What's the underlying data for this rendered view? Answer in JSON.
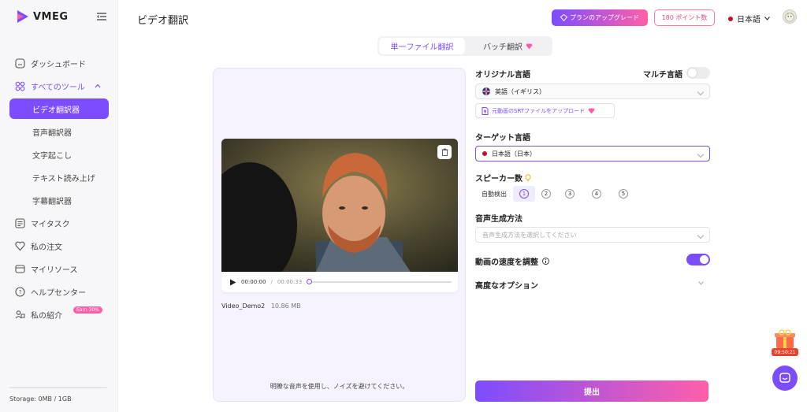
{
  "app": {
    "name": "VMEG"
  },
  "sidebar": {
    "items": [
      {
        "label": "ダッシュボード"
      },
      {
        "label": "すべてのツール"
      },
      {
        "label": "ビデオ翻訳器"
      },
      {
        "label": "音声翻訳器"
      },
      {
        "label": "文字起こし"
      },
      {
        "label": "テキスト読み上げ"
      },
      {
        "label": "字幕翻訳器"
      },
      {
        "label": "マイタスク"
      },
      {
        "label": "私の注文"
      },
      {
        "label": "マイリソース"
      },
      {
        "label": "ヘルプセンター"
      },
      {
        "label": "私の紹介",
        "badge": "Earn 30%"
      }
    ],
    "storage": "Storage: 0MB / 1GB"
  },
  "header": {
    "title": "ビデオ翻訳",
    "upgrade_label": "プランのアップグレード",
    "points_label": "180 ポイント数",
    "language": "日本語"
  },
  "mode_tabs": [
    {
      "label": "単一ファイル翻訳"
    },
    {
      "label": "バッチ翻訳"
    }
  ],
  "video": {
    "time_current": "00:00:00",
    "time_total": "00:00:33",
    "file_name": "Video_Demo2",
    "file_size": "10.86 MB",
    "hint": "明瞭な音声を使用し、ノイズを避けてください。"
  },
  "settings": {
    "original_language_label": "オリジナル言語",
    "multi_language_label": "マルチ言語",
    "multi_language_on": false,
    "original_language_value": "英語（イギリス）",
    "srt_upload_label": "元動画のSRTファイルをアップロード",
    "target_language_label": "ターゲット言語",
    "target_language_value": "日本語（日本）",
    "speaker_count_label": "スピーカー数",
    "speaker_options": [
      "自動検出",
      "1",
      "2",
      "3",
      "4",
      "5"
    ],
    "voice_method_label": "音声生成方法",
    "voice_method_placeholder": "音声生成方法を選択してください",
    "speed_adjust_label": "動画の速度を調整",
    "speed_adjust_on": true,
    "advanced_label": "高度なオプション",
    "submit_label": "提出"
  },
  "floating": {
    "gift_timer": "09:50:21"
  },
  "colors": {
    "accent": "#7c4dff",
    "pink": "#ff5fa8"
  }
}
